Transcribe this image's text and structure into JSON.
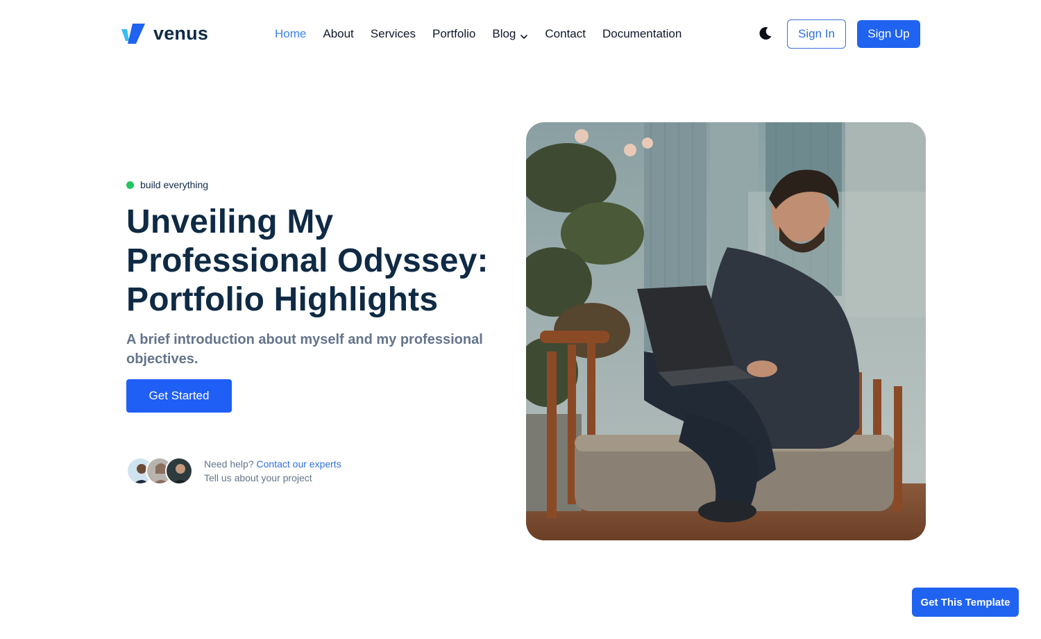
{
  "brand": {
    "name": "venus",
    "accent": "#1f63f0",
    "logo_icon": "venus-logo-icon"
  },
  "nav": {
    "items": [
      {
        "label": "Home",
        "active": true
      },
      {
        "label": "About"
      },
      {
        "label": "Services"
      },
      {
        "label": "Portfolio"
      },
      {
        "label": "Blog",
        "has_dropdown": true
      },
      {
        "label": "Contact"
      },
      {
        "label": "Documentation"
      }
    ],
    "theme_icon": "moon-icon",
    "signin_label": "Sign In",
    "signup_label": "Sign Up"
  },
  "hero": {
    "tag": "build everything",
    "title_lines": [
      "Unveiling My",
      "Professional Odyssey:",
      "Portfolio Highlights"
    ],
    "subtitle": "A brief introduction about myself and my professional objectives.",
    "cta_label": "Get Started",
    "help_prefix": "Need help?",
    "help_link": "Contact our experts",
    "help_line2": "Tell us about your project",
    "image_icon": "hero-photo"
  },
  "floating_cta": {
    "label": "Get This Template"
  },
  "colors": {
    "primary": "#1f63f0",
    "heading": "#0f2a44",
    "muted": "#64748b",
    "status_green": "#22c55e"
  }
}
